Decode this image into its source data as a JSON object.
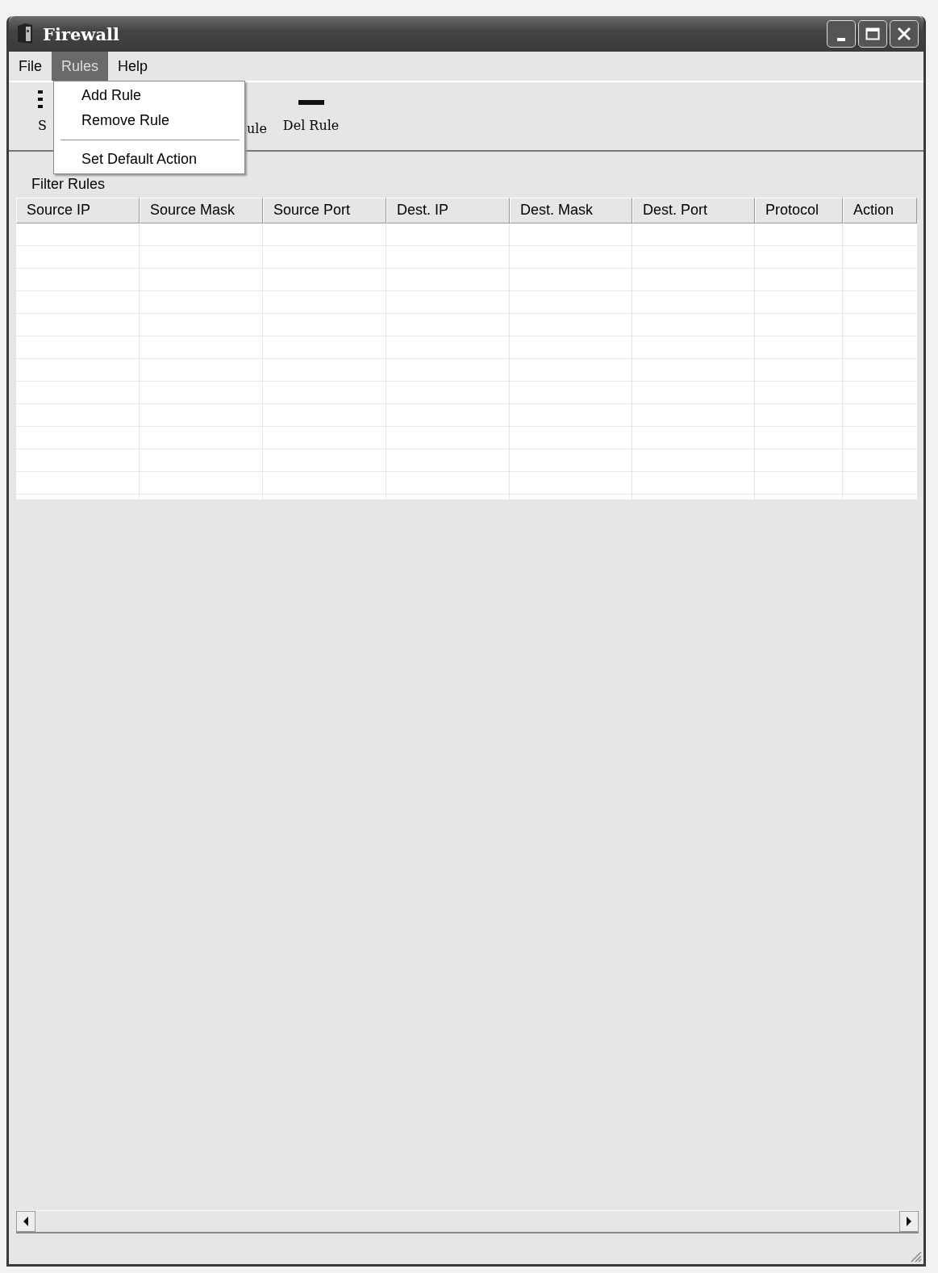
{
  "window": {
    "title": "Firewall"
  },
  "menu_bar": [
    {
      "label": "File",
      "selected": false
    },
    {
      "label": "Rules",
      "selected": true
    },
    {
      "label": "Help",
      "selected": false
    }
  ],
  "open_menu": {
    "items": [
      {
        "kind": "item",
        "label": "Add Rule"
      },
      {
        "kind": "item",
        "label": "Remove Rule"
      },
      {
        "kind": "separator"
      },
      {
        "kind": "item",
        "label": "Set Default Action"
      }
    ]
  },
  "toolbar": [
    {
      "kind": "partial-left",
      "label": "S"
    },
    {
      "kind": "partial-right",
      "label": "ule"
    },
    {
      "kind": "del",
      "label": "Del Rule"
    }
  ],
  "group": {
    "label": "Filter Rules"
  },
  "table": {
    "columns": [
      "Source IP",
      "Source Mask",
      "Source Port",
      "Dest. IP",
      "Dest. Mask",
      "Dest. Port",
      "Protocol",
      "Action"
    ]
  }
}
